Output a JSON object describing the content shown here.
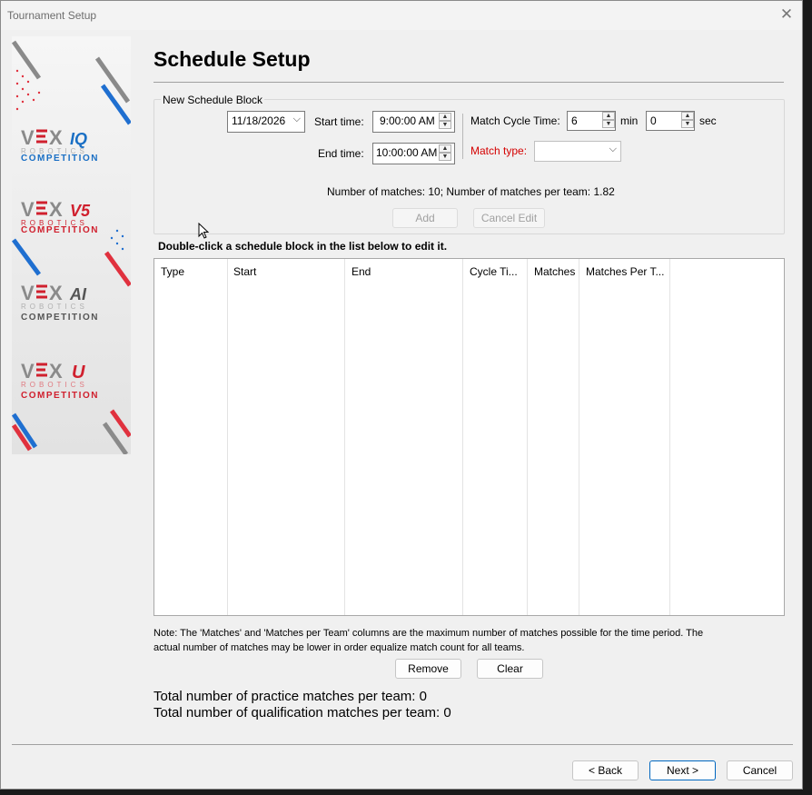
{
  "window": {
    "title": "Tournament Setup"
  },
  "sidebar": {
    "logos": [
      {
        "brand": "VEX",
        "suffix": "IQ",
        "sub": "ROBOTICS",
        "comp": "COMPETITION",
        "accent": "#1a6fc4"
      },
      {
        "brand": "VEX",
        "suffix": "V5",
        "sub": "ROBOTICS",
        "comp": "COMPETITION",
        "accent": "#d0202e"
      },
      {
        "brand": "VEX",
        "suffix": "AI",
        "sub": "ROBOTICS",
        "comp": "COMPETITION",
        "accent": "#555555"
      },
      {
        "brand": "VEX",
        "suffix": "U",
        "sub": "ROBOTICS",
        "comp": "COMPETITION",
        "accent": "#d0202e"
      }
    ]
  },
  "page": {
    "heading": "Schedule Setup"
  },
  "block": {
    "group_title": "New Schedule Block",
    "date": "11/18/2026",
    "start_label": "Start time:",
    "start_time": "9:00:00 AM",
    "end_label": "End time:",
    "end_time": "10:00:00 AM",
    "cycle_label": "Match Cycle Time:",
    "cycle_min": "6",
    "min_label": "min",
    "cycle_sec": "0",
    "sec_label": "sec",
    "match_type_label": "Match type:",
    "match_type_value": "",
    "matches_info": "Number of matches: 10; Number of matches per team: 1.82",
    "add_label": "Add",
    "cancel_edit_label": "Cancel Edit"
  },
  "list": {
    "instruction": "Double-click a schedule block in the list below to edit it.",
    "columns": [
      "Type",
      "Start",
      "End",
      "Cycle Ti...",
      "Matches",
      "Matches Per T..."
    ]
  },
  "note": "Note: The 'Matches' and 'Matches per Team' columns are the maximum number of matches possible for the time period.  The actual number of matches may be lower in order equalize match count for all teams.",
  "actions": {
    "remove_label": "Remove",
    "clear_label": "Clear"
  },
  "totals": {
    "practice": "Total number of practice matches per team: 0",
    "qualification": "Total number of qualification matches per team: 0"
  },
  "footer": {
    "back_label": "< Back",
    "next_label": "Next >",
    "cancel_label": "Cancel"
  }
}
